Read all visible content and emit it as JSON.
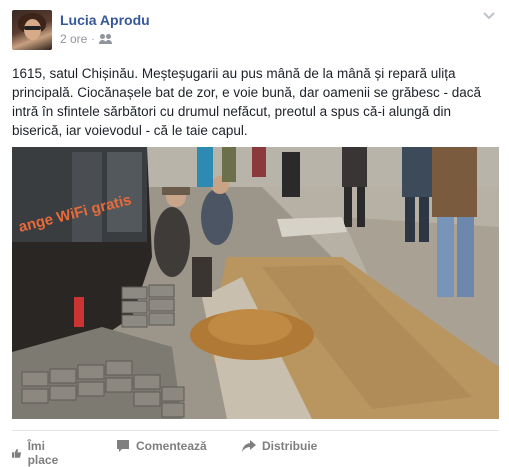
{
  "post": {
    "author": "Lucia Aprodu",
    "time": "2 ore",
    "privacy_icon": "friends-icon",
    "text": "1615, satul Chișinău. Meșteșugarii au pus mână de la mână și repară ulița principală. Ciocănașele bat de zor, e voie bună, dar oamenii se grăbesc - dacă intră în sfintele sărbători cu drumul nefăcut, preotul a spus că-i alungă din biserică, iar voievodul - că le taie capul.",
    "photo": {
      "bus_text": "ange WiFi gratis"
    }
  },
  "actions": {
    "like": "Îmi place",
    "comment": "Comentează",
    "share": "Distribuie"
  },
  "colors": {
    "link": "#365899",
    "meta": "#90949c",
    "action": "#7f7f7f"
  }
}
